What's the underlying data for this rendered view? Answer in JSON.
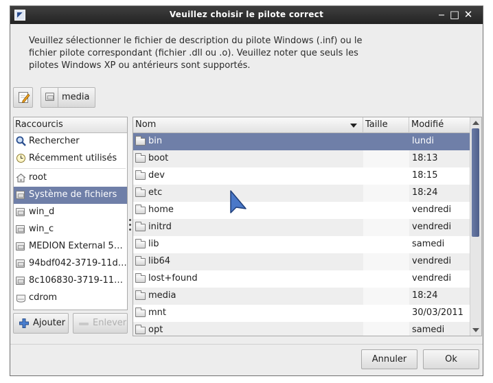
{
  "window": {
    "title": "Veuillez choisir le pilote correct",
    "controls": {
      "minimize": "‒",
      "maximize": "□",
      "close": "✕"
    }
  },
  "description": "Veuillez sélectionner le fichier de description du pilote Windows (.inf) ou le fichier pilote correspondant (fichier .dll ou .o). Veuillez noter que seuls les pilotes Windows XP ou antérieurs sont supportés.",
  "path_bar": {
    "current": "media"
  },
  "places": {
    "header": "Raccourcis",
    "items": [
      {
        "label": "Rechercher",
        "icon": "search-icon"
      },
      {
        "label": "Récemment utilisés",
        "icon": "clock-icon"
      },
      {
        "label": "root",
        "icon": "home-icon"
      },
      {
        "label": "Système de fichiers",
        "icon": "drive-icon",
        "selected": true
      },
      {
        "label": "win_d",
        "icon": "drive-icon"
      },
      {
        "label": "win_c",
        "icon": "drive-icon"
      },
      {
        "label": "MEDION External 5…",
        "icon": "drive-icon"
      },
      {
        "label": "94bdf042-3719-11d…",
        "icon": "drive-icon"
      },
      {
        "label": "8c106830-3719-11…",
        "icon": "drive-icon"
      },
      {
        "label": "cdrom",
        "icon": "cdrom-icon"
      }
    ],
    "add_label": "Ajouter",
    "remove_label": "Enlever"
  },
  "files": {
    "columns": {
      "name": "Nom",
      "size": "Taille",
      "modified": "Modifié"
    },
    "rows": [
      {
        "name": "bin",
        "size": "",
        "modified": "lundi",
        "selected": true
      },
      {
        "name": "boot",
        "size": "",
        "modified": "18:13"
      },
      {
        "name": "dev",
        "size": "",
        "modified": "18:15"
      },
      {
        "name": "etc",
        "size": "",
        "modified": "18:24"
      },
      {
        "name": "home",
        "size": "",
        "modified": "vendredi"
      },
      {
        "name": "initrd",
        "size": "",
        "modified": "vendredi"
      },
      {
        "name": "lib",
        "size": "",
        "modified": "samedi"
      },
      {
        "name": "lib64",
        "size": "",
        "modified": "vendredi"
      },
      {
        "name": "lost+found",
        "size": "",
        "modified": "vendredi"
      },
      {
        "name": "media",
        "size": "",
        "modified": "18:24"
      },
      {
        "name": "mnt",
        "size": "",
        "modified": "30/03/2011"
      },
      {
        "name": "opt",
        "size": "",
        "modified": "samedi"
      }
    ]
  },
  "buttons": {
    "cancel": "Annuler",
    "ok": "Ok"
  },
  "colors": {
    "selection": "#6f7fa8",
    "titlebar": "#2b2b2b",
    "accent": "#4f5f8a"
  }
}
